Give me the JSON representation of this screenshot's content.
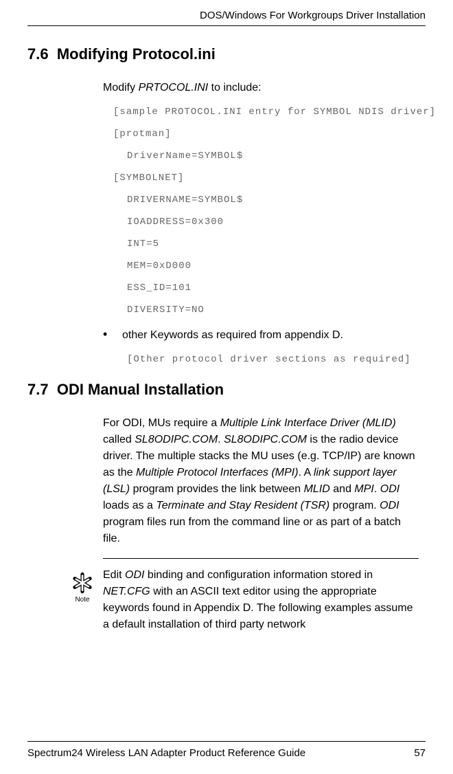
{
  "header": {
    "running_title": "DOS/Windows For Workgroups Driver Installation"
  },
  "section1": {
    "number": "7.6",
    "title": "Modifying Protocol.ini",
    "intro_pre": "Modify ",
    "intro_italic": "PRTOCOL.INI",
    "intro_post": " to include:",
    "code": {
      "l1": "[sample PROTOCOL.INI entry for SYMBOL NDIS driver]",
      "l2": "[protman]",
      "l3": "DriverName=SYMBOL$",
      "l4": "[SYMBOLNET]",
      "l5": "DRIVERNAME=SYMBOL$",
      "l6": "IOADDRESS=0x300",
      "l7": "INT=5",
      "l8": "MEM=0xD000",
      "l9": "ESS_ID=101",
      "l10": "DIVERSITY=NO"
    },
    "bullet": "other Keywords as required from appendix D.",
    "code_after": "[Other protocol driver sections as required]"
  },
  "section2": {
    "number": "7.7",
    "title": "ODI Manual Installation",
    "para": {
      "t1": "For ODI, MUs require a ",
      "i1": "Multiple Link Interface Driver (MLID)",
      "t2": " called ",
      "i2": "SL8ODIPC.COM",
      "t3": ". ",
      "i3": "SL8ODIPC.COM",
      "t4": " is the radio device driver. The multiple stacks the MU uses (e.g. TCP/IP) are known as the ",
      "i4": "Multiple Protocol Interfaces (MPI)",
      "t5": ". A ",
      "i5": "link support layer (LSL)",
      "t6": " program provides the link between ",
      "i6": "MLID",
      "t7": " and ",
      "i7": "MPI",
      "t8": ". ",
      "i8": "ODI",
      "t9": " loads as a ",
      "i9": "Terminate and Stay Resident (TSR)",
      "t10": " program. ",
      "i10": "ODI",
      "t11": " program files run from the command line or as part of a batch file."
    }
  },
  "note": {
    "label": "Note",
    "t1": "Edit ",
    "i1": "ODI",
    "t2": " binding and configuration information stored in ",
    "i2": "NET.CFG",
    "t3": " with an ASCII text editor using the appropriate keywords found in Appendix D. The following examples assume a default installation of third party network"
  },
  "footer": {
    "title": "Spectrum24 Wireless LAN Adapter Product Reference Guide",
    "page": "57"
  }
}
